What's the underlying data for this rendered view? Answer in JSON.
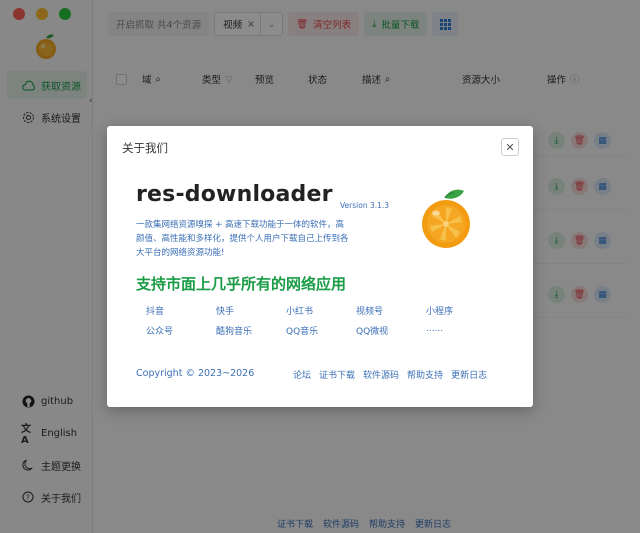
{
  "sidebar": {
    "items": [
      {
        "label": "获取资源",
        "icon": "cloud-icon"
      },
      {
        "label": "系统设置",
        "icon": "gear-icon"
      }
    ],
    "bottom_items": [
      {
        "label": "github",
        "icon": "github-icon"
      },
      {
        "label": "English",
        "icon": "translate-icon"
      },
      {
        "label": "主题更换",
        "icon": "moon-icon"
      },
      {
        "label": "关于我们",
        "icon": "info-icon"
      }
    ]
  },
  "toolbar": {
    "capture_status": "开启抓取 共4个资源",
    "filter_value": "视频",
    "clear_label": "清空列表",
    "batch_download_label": "批量下载"
  },
  "table": {
    "headers": {
      "domain": "域",
      "type": "类型",
      "preview": "预览",
      "status": "状态",
      "description": "描述",
      "size": "资源大小",
      "actions": "操作"
    }
  },
  "footer": {
    "links": [
      "证书下载",
      "软件源码",
      "帮助支持",
      "更新日志"
    ]
  },
  "dialog": {
    "title": "关于我们",
    "app_name": "res-downloader",
    "version": "Version 3.1.3",
    "description": "一款集网络资源嗅探 + 高速下载功能于一体的软件，高颜值、高性能和多样化，提供个人用户下载自己上传到各大平台的网络资源功能!",
    "slogan": "支持市面上几乎所有的网络应用",
    "platforms": [
      "抖音",
      "快手",
      "小红书",
      "视频号",
      "小程序",
      "公众号",
      "酷狗音乐",
      "QQ音乐",
      "QQ微视",
      "......"
    ],
    "copyright": "Copyright © 2023~2026",
    "links": [
      "论坛",
      "证书下载",
      "软件源码",
      "帮助支持",
      "更新日志"
    ]
  },
  "colors": {
    "accent_green": "#1a9c46",
    "link_blue": "#3b6fb6",
    "danger_red": "#e5484d"
  }
}
